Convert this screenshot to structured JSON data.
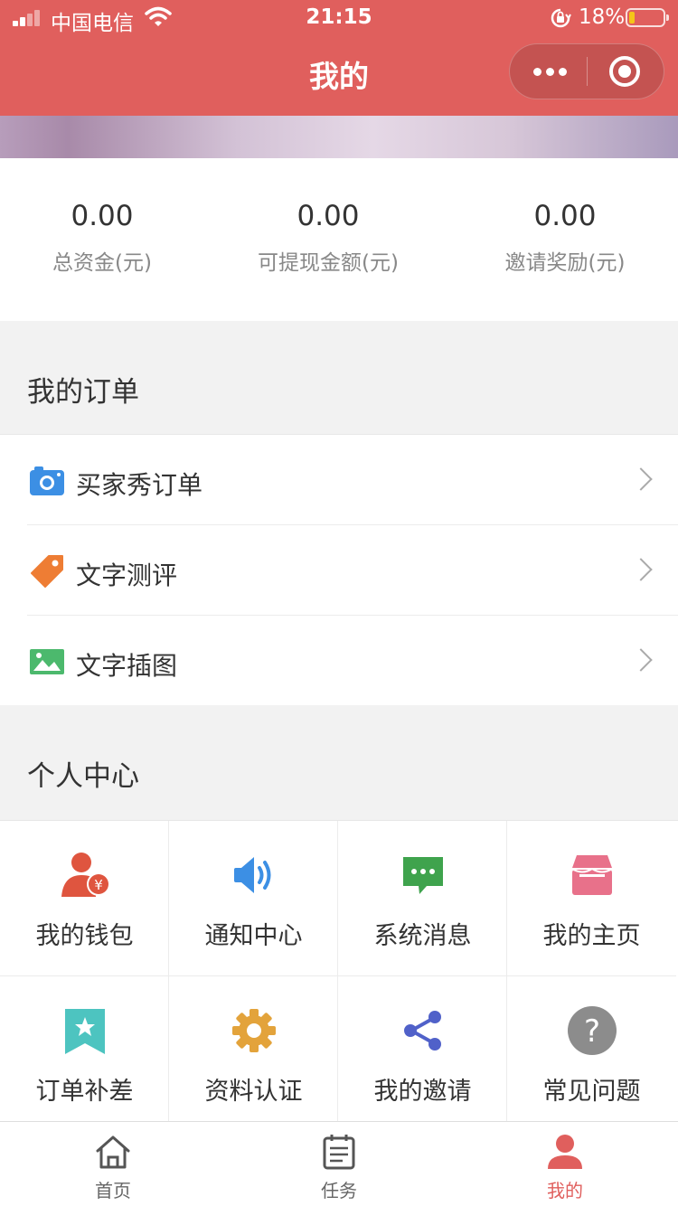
{
  "status_bar": {
    "carrier": "中国电信",
    "time": "21:15",
    "battery_percent": "18%",
    "battery_level": 0.18,
    "signal_bars_lit": 2,
    "signal_bars_total": 4
  },
  "nav": {
    "title": "我的"
  },
  "colors": {
    "primary": "#e05f5d",
    "camera": "#3c8fe4",
    "tag": "#ee7d34",
    "image": "#4cb96d",
    "wallet": "#df553f",
    "notice": "#3c8fe4",
    "message": "#3fa34d",
    "home": "#e8718a",
    "bookmark": "#4dc4c0",
    "gear": "#e3a33b",
    "share": "#5061c9",
    "help": "#8c8c8c"
  },
  "stats": [
    {
      "value": "0.00",
      "label": "总资金(元)"
    },
    {
      "value": "0.00",
      "label": "可提现金额(元)"
    },
    {
      "value": "0.00",
      "label": "邀请奖励(元)"
    }
  ],
  "orders_section": {
    "title": "我的订单",
    "items": [
      {
        "label": "买家秀订单",
        "icon": "camera-icon"
      },
      {
        "label": "文字测评",
        "icon": "tag-icon"
      },
      {
        "label": "文字插图",
        "icon": "image-icon"
      }
    ]
  },
  "personal_section": {
    "title": "个人中心",
    "items": [
      {
        "label": "我的钱包",
        "icon": "wallet-icon"
      },
      {
        "label": "通知中心",
        "icon": "speaker-icon"
      },
      {
        "label": "系统消息",
        "icon": "message-icon"
      },
      {
        "label": "我的主页",
        "icon": "store-icon"
      },
      {
        "label": "订单补差",
        "icon": "bookmark-star-icon"
      },
      {
        "label": "资料认证",
        "icon": "gear-icon"
      },
      {
        "label": "我的邀请",
        "icon": "share-icon"
      },
      {
        "label": "常见问题",
        "icon": "help-icon"
      }
    ]
  },
  "tabbar": {
    "active": 2,
    "items": [
      {
        "label": "首页",
        "icon": "home-icon"
      },
      {
        "label": "任务",
        "icon": "task-icon"
      },
      {
        "label": "我的",
        "icon": "user-icon"
      }
    ]
  }
}
